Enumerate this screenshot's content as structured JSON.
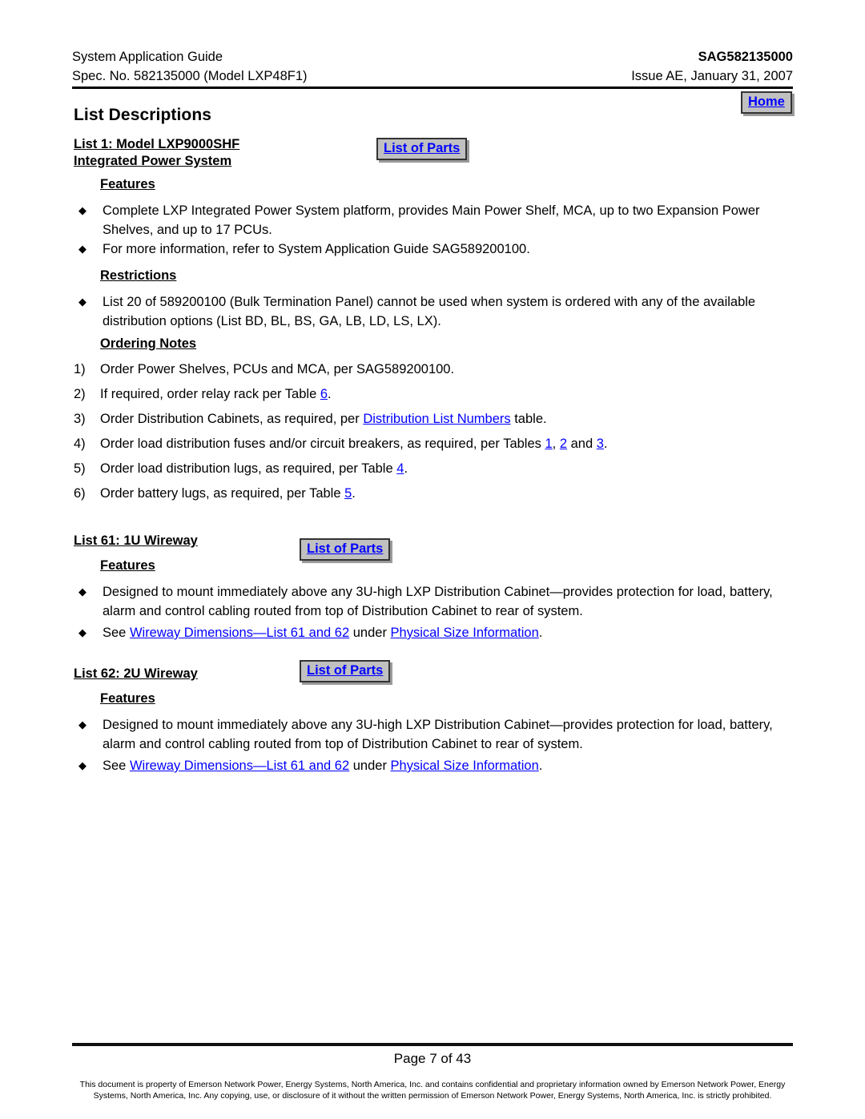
{
  "header": {
    "left_line1": "System Application Guide",
    "left_line2": "Spec. No. 582135000 (Model LXP48F1)",
    "right_line1": "SAG582135000",
    "right_line2": "Issue AE, January 31, 2007"
  },
  "home_button": {
    "label": "Home"
  },
  "title": "List Descriptions",
  "colors": {
    "link": "#0000FF",
    "button_face": "#C0C0C0",
    "button_border": "#333333",
    "text": "#000000"
  },
  "icons": {
    "bullet": "diamond-bullet"
  },
  "section1": {
    "heading_line1": "List 1:  Model LXP9000SHF",
    "heading_line2": "Integrated Power System",
    "parts_button": "List of Parts",
    "features_label": "Features",
    "features": [
      "Complete LXP Integrated Power System platform, provides Main Power Shelf, MCA, up to two Expansion Power Shelves, and up to 17 PCUs.",
      "For more information, refer to System Application Guide SAG589200100."
    ],
    "restrictions_label": "Restrictions",
    "restrictions": [
      "List 20 of 589200100 (Bulk Termination Panel) cannot be used when system is ordered with any of the available distribution options (List BD, BL, BS, GA, LB, LD, LS, LX)."
    ],
    "ordering_label": "Ordering Notes",
    "ordering_notes": [
      {
        "num": "1)",
        "pre": "Order Power Shelves, PCUs and MCA, per SAG589200100.",
        "links": []
      },
      {
        "num": "2)",
        "pre": "If required, order relay rack per Table ",
        "link1": "6",
        "post": "."
      },
      {
        "num": "3)",
        "pre": "Order Distribution Cabinets, as required, per ",
        "link1": "Distribution List Numbers",
        "post": " table."
      },
      {
        "num": "4)",
        "pre": "Order load distribution fuses and/or circuit breakers, as required, per Tables ",
        "link1": "1",
        "mid1": ", ",
        "link2": "2",
        "mid2": " and ",
        "link3": "3",
        "post": "."
      },
      {
        "num": "5)",
        "pre": "Order load distribution lugs, as required, per Table ",
        "link1": "4",
        "post": "."
      },
      {
        "num": "6)",
        "pre": "Order battery lugs, as required, per Table ",
        "link1": "5",
        "post": "."
      }
    ]
  },
  "section61": {
    "heading": "List 61:  1U Wireway",
    "parts_button": "List of Parts",
    "features_label": "Features",
    "feature1": "Designed to mount immediately above any 3U-high LXP Distribution Cabinet—provides protection for load, battery, alarm and control cabling routed from top of Distribution Cabinet to rear of system.",
    "feature2_pre": "See ",
    "feature2_link1": "Wireway Dimensions—List 61 and 62",
    "feature2_mid": " under ",
    "feature2_link2": "Physical Size Information",
    "feature2_post": "."
  },
  "section62": {
    "heading": "List 62:  2U Wireway",
    "parts_button": "List of Parts",
    "features_label": "Features",
    "feature1": "Designed to mount immediately above any 3U-high LXP Distribution Cabinet—provides protection for load, battery, alarm and control cabling routed from top of Distribution Cabinet to rear of system.",
    "feature2_pre": "See ",
    "feature2_link1": "Wireway Dimensions—List 61 and 62",
    "feature2_mid": " under ",
    "feature2_link2": "Physical Size Information",
    "feature2_post": "."
  },
  "footer": {
    "page_label": "Page 7 of 43",
    "legal_line1": "This document is property of Emerson Network Power, Energy Systems, North America, Inc. and contains confidential and proprietary information owned by Emerson Network Power, Energy",
    "legal_line2": "Systems, North America, Inc.  Any copying, use, or disclosure of it without the written permission of Emerson Network Power, Energy Systems, North America, Inc. is strictly prohibited."
  }
}
